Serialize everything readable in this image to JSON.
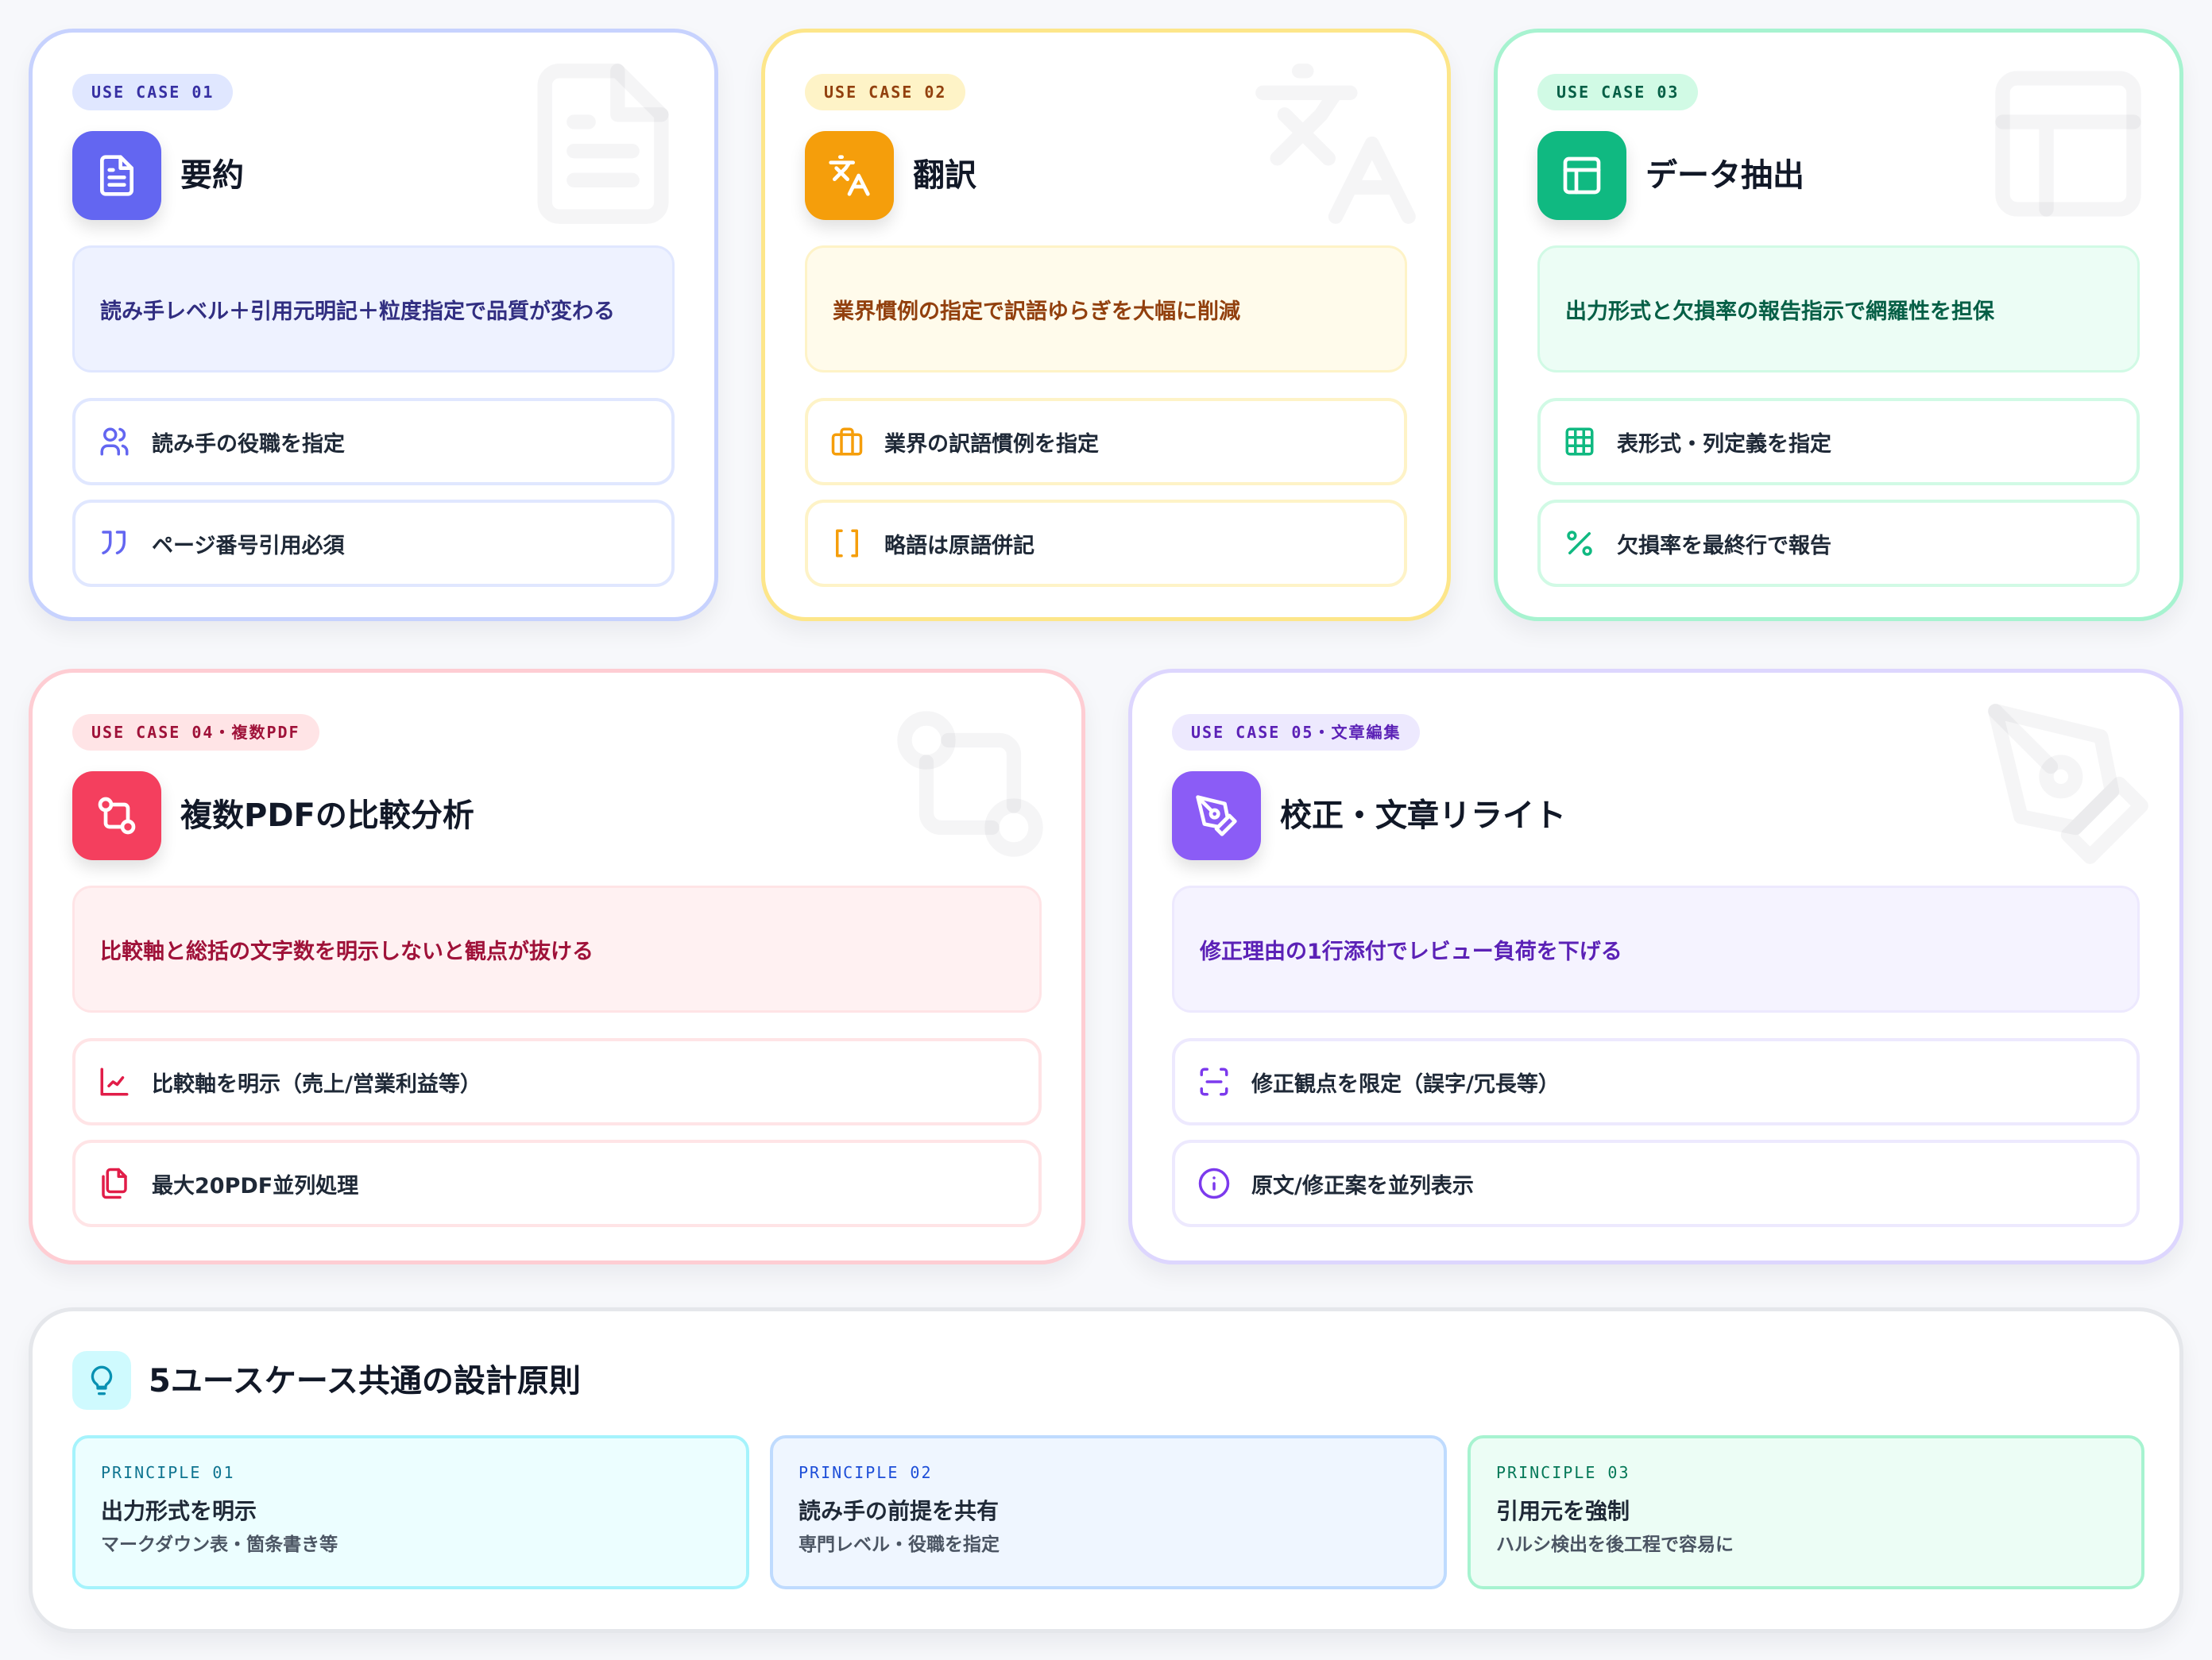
{
  "use_cases": [
    {
      "badge": "USE CASE 01",
      "title": "要約",
      "note": "読み手レベル＋引用元明記＋粒度指定で品質が変わる",
      "items": [
        {
          "icon": "users-icon",
          "label": "読み手の役職を指定"
        },
        {
          "icon": "quote-icon",
          "label": "ページ番号引用必須"
        }
      ],
      "icon": "document-icon",
      "accent": "#6366f1"
    },
    {
      "badge": "USE CASE 02",
      "title": "翻訳",
      "note": "業界慣例の指定で訳語ゆらぎを大幅に削減",
      "items": [
        {
          "icon": "briefcase-icon",
          "label": "業界の訳語慣例を指定"
        },
        {
          "icon": "brackets-icon",
          "label": "略語は原語併記"
        }
      ],
      "icon": "translate-icon",
      "accent": "#f59e0b"
    },
    {
      "badge": "USE CASE 03",
      "title": "データ抽出",
      "note": "出力形式と欠損率の報告指示で網羅性を担保",
      "items": [
        {
          "icon": "table-icon",
          "label": "表形式・列定義を指定"
        },
        {
          "icon": "percent-icon",
          "label": "欠損率を最終行で報告"
        }
      ],
      "icon": "layout-icon",
      "accent": "#10b981"
    },
    {
      "badge": "USE CASE 04・複数PDF",
      "title": "複数PDFの比較分析",
      "note": "比較軸と総括の文字数を明示しないと観点が抜ける",
      "items": [
        {
          "icon": "chart-icon",
          "label": "比較軸を明示（売上/営業利益等）"
        },
        {
          "icon": "files-icon",
          "label": "最大20PDF並列処理"
        }
      ],
      "icon": "compare-icon",
      "accent": "#f43f5e"
    },
    {
      "badge": "USE CASE 05・文章編集",
      "title": "校正・文章リライト",
      "note": "修正理由の1行添付でレビュー負荷を下げる",
      "items": [
        {
          "icon": "scan-icon",
          "label": "修正観点を限定（誤字/冗長等）"
        },
        {
          "icon": "info-icon",
          "label": "原文/修正案を並列表示"
        }
      ],
      "icon": "pen-icon",
      "accent": "#8b5cf6"
    }
  ],
  "principles": {
    "title": "5ユースケース共通の設計原則",
    "icon": "lightbulb-icon",
    "items": [
      {
        "label": "PRINCIPLE 01",
        "title": "出力形式を明示",
        "desc": "マークダウン表・箇条書き等"
      },
      {
        "label": "PRINCIPLE 02",
        "title": "読み手の前提を共有",
        "desc": "専門レベル・役職を指定"
      },
      {
        "label": "PRINCIPLE 03",
        "title": "引用元を強制",
        "desc": "ハルシ検出を後工程で容易に"
      }
    ]
  }
}
